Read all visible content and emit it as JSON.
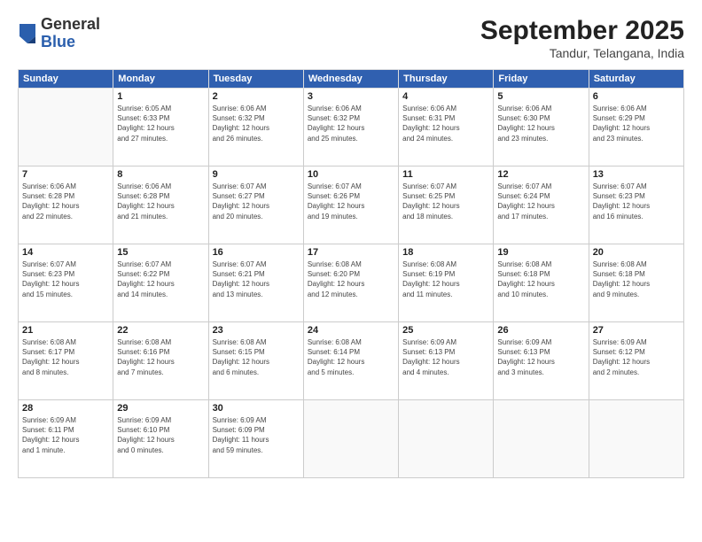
{
  "header": {
    "logo": {
      "general": "General",
      "blue": "Blue"
    },
    "title": "September 2025",
    "subtitle": "Tandur, Telangana, India"
  },
  "days_of_week": [
    "Sunday",
    "Monday",
    "Tuesday",
    "Wednesday",
    "Thursday",
    "Friday",
    "Saturday"
  ],
  "weeks": [
    [
      {
        "num": "",
        "info": ""
      },
      {
        "num": "1",
        "info": "Sunrise: 6:05 AM\nSunset: 6:33 PM\nDaylight: 12 hours\nand 27 minutes."
      },
      {
        "num": "2",
        "info": "Sunrise: 6:06 AM\nSunset: 6:32 PM\nDaylight: 12 hours\nand 26 minutes."
      },
      {
        "num": "3",
        "info": "Sunrise: 6:06 AM\nSunset: 6:32 PM\nDaylight: 12 hours\nand 25 minutes."
      },
      {
        "num": "4",
        "info": "Sunrise: 6:06 AM\nSunset: 6:31 PM\nDaylight: 12 hours\nand 24 minutes."
      },
      {
        "num": "5",
        "info": "Sunrise: 6:06 AM\nSunset: 6:30 PM\nDaylight: 12 hours\nand 23 minutes."
      },
      {
        "num": "6",
        "info": "Sunrise: 6:06 AM\nSunset: 6:29 PM\nDaylight: 12 hours\nand 23 minutes."
      }
    ],
    [
      {
        "num": "7",
        "info": "Sunrise: 6:06 AM\nSunset: 6:28 PM\nDaylight: 12 hours\nand 22 minutes."
      },
      {
        "num": "8",
        "info": "Sunrise: 6:06 AM\nSunset: 6:28 PM\nDaylight: 12 hours\nand 21 minutes."
      },
      {
        "num": "9",
        "info": "Sunrise: 6:07 AM\nSunset: 6:27 PM\nDaylight: 12 hours\nand 20 minutes."
      },
      {
        "num": "10",
        "info": "Sunrise: 6:07 AM\nSunset: 6:26 PM\nDaylight: 12 hours\nand 19 minutes."
      },
      {
        "num": "11",
        "info": "Sunrise: 6:07 AM\nSunset: 6:25 PM\nDaylight: 12 hours\nand 18 minutes."
      },
      {
        "num": "12",
        "info": "Sunrise: 6:07 AM\nSunset: 6:24 PM\nDaylight: 12 hours\nand 17 minutes."
      },
      {
        "num": "13",
        "info": "Sunrise: 6:07 AM\nSunset: 6:23 PM\nDaylight: 12 hours\nand 16 minutes."
      }
    ],
    [
      {
        "num": "14",
        "info": "Sunrise: 6:07 AM\nSunset: 6:23 PM\nDaylight: 12 hours\nand 15 minutes."
      },
      {
        "num": "15",
        "info": "Sunrise: 6:07 AM\nSunset: 6:22 PM\nDaylight: 12 hours\nand 14 minutes."
      },
      {
        "num": "16",
        "info": "Sunrise: 6:07 AM\nSunset: 6:21 PM\nDaylight: 12 hours\nand 13 minutes."
      },
      {
        "num": "17",
        "info": "Sunrise: 6:08 AM\nSunset: 6:20 PM\nDaylight: 12 hours\nand 12 minutes."
      },
      {
        "num": "18",
        "info": "Sunrise: 6:08 AM\nSunset: 6:19 PM\nDaylight: 12 hours\nand 11 minutes."
      },
      {
        "num": "19",
        "info": "Sunrise: 6:08 AM\nSunset: 6:18 PM\nDaylight: 12 hours\nand 10 minutes."
      },
      {
        "num": "20",
        "info": "Sunrise: 6:08 AM\nSunset: 6:18 PM\nDaylight: 12 hours\nand 9 minutes."
      }
    ],
    [
      {
        "num": "21",
        "info": "Sunrise: 6:08 AM\nSunset: 6:17 PM\nDaylight: 12 hours\nand 8 minutes."
      },
      {
        "num": "22",
        "info": "Sunrise: 6:08 AM\nSunset: 6:16 PM\nDaylight: 12 hours\nand 7 minutes."
      },
      {
        "num": "23",
        "info": "Sunrise: 6:08 AM\nSunset: 6:15 PM\nDaylight: 12 hours\nand 6 minutes."
      },
      {
        "num": "24",
        "info": "Sunrise: 6:08 AM\nSunset: 6:14 PM\nDaylight: 12 hours\nand 5 minutes."
      },
      {
        "num": "25",
        "info": "Sunrise: 6:09 AM\nSunset: 6:13 PM\nDaylight: 12 hours\nand 4 minutes."
      },
      {
        "num": "26",
        "info": "Sunrise: 6:09 AM\nSunset: 6:13 PM\nDaylight: 12 hours\nand 3 minutes."
      },
      {
        "num": "27",
        "info": "Sunrise: 6:09 AM\nSunset: 6:12 PM\nDaylight: 12 hours\nand 2 minutes."
      }
    ],
    [
      {
        "num": "28",
        "info": "Sunrise: 6:09 AM\nSunset: 6:11 PM\nDaylight: 12 hours\nand 1 minute."
      },
      {
        "num": "29",
        "info": "Sunrise: 6:09 AM\nSunset: 6:10 PM\nDaylight: 12 hours\nand 0 minutes."
      },
      {
        "num": "30",
        "info": "Sunrise: 6:09 AM\nSunset: 6:09 PM\nDaylight: 11 hours\nand 59 minutes."
      },
      {
        "num": "",
        "info": ""
      },
      {
        "num": "",
        "info": ""
      },
      {
        "num": "",
        "info": ""
      },
      {
        "num": "",
        "info": ""
      }
    ]
  ]
}
